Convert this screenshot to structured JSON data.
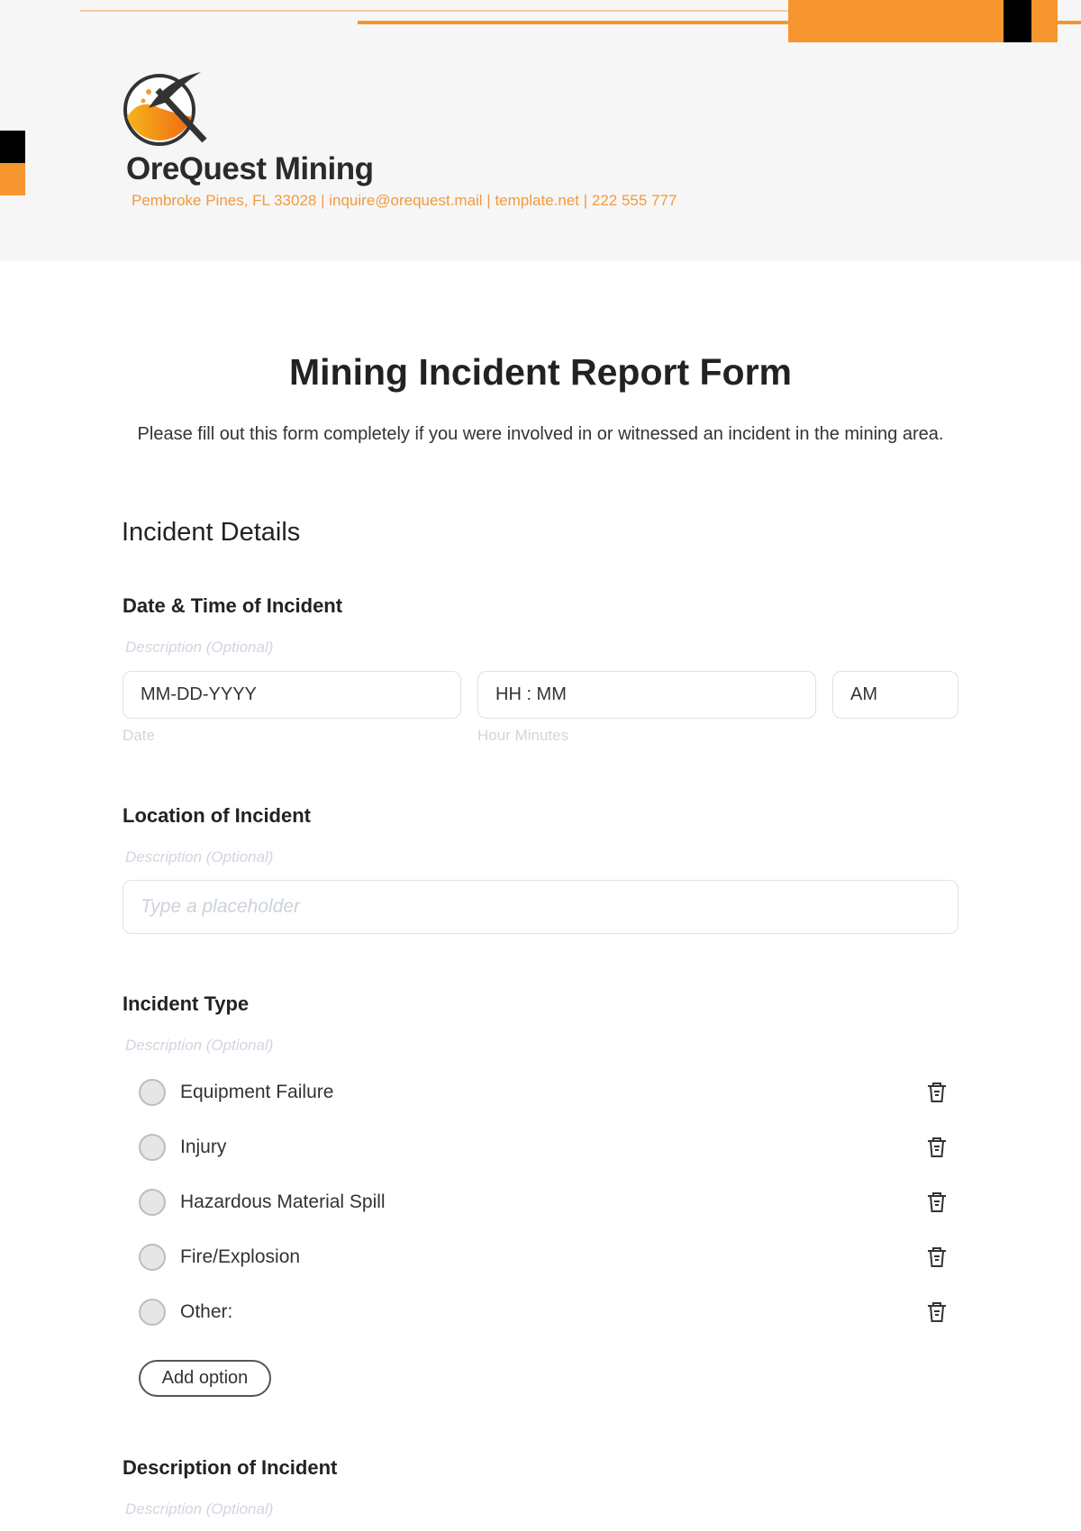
{
  "company": {
    "name": "OreQuest Mining",
    "contact": "Pembroke Pines, FL 33028 | inquire@orequest.mail | template.net | 222 555 777",
    "accent": "#f7952f"
  },
  "form": {
    "title": "Mining Incident Report Form",
    "intro": "Please fill out this form completely if you were involved in or witnessed an incident in the mining area.",
    "section": "Incident Details",
    "q_datetime": {
      "label": "Date & Time of Incident",
      "desc": "Description (Optional)",
      "date_value": "MM-DD-YYYY",
      "date_sub": "Date",
      "time_value": "HH : MM",
      "time_sub": "Hour Minutes",
      "ampm": "AM"
    },
    "q_location": {
      "label": "Location of Incident",
      "desc": "Description (Optional)",
      "placeholder": "Type a placeholder"
    },
    "q_type": {
      "label": "Incident Type",
      "desc": "Description (Optional)",
      "options": [
        "Equipment Failure",
        "Injury",
        "Hazardous Material Spill",
        "Fire/Explosion",
        "Other:"
      ],
      "add_option": "Add option"
    },
    "q_description": {
      "label": "Description of Incident",
      "desc": "Description (Optional)"
    }
  }
}
